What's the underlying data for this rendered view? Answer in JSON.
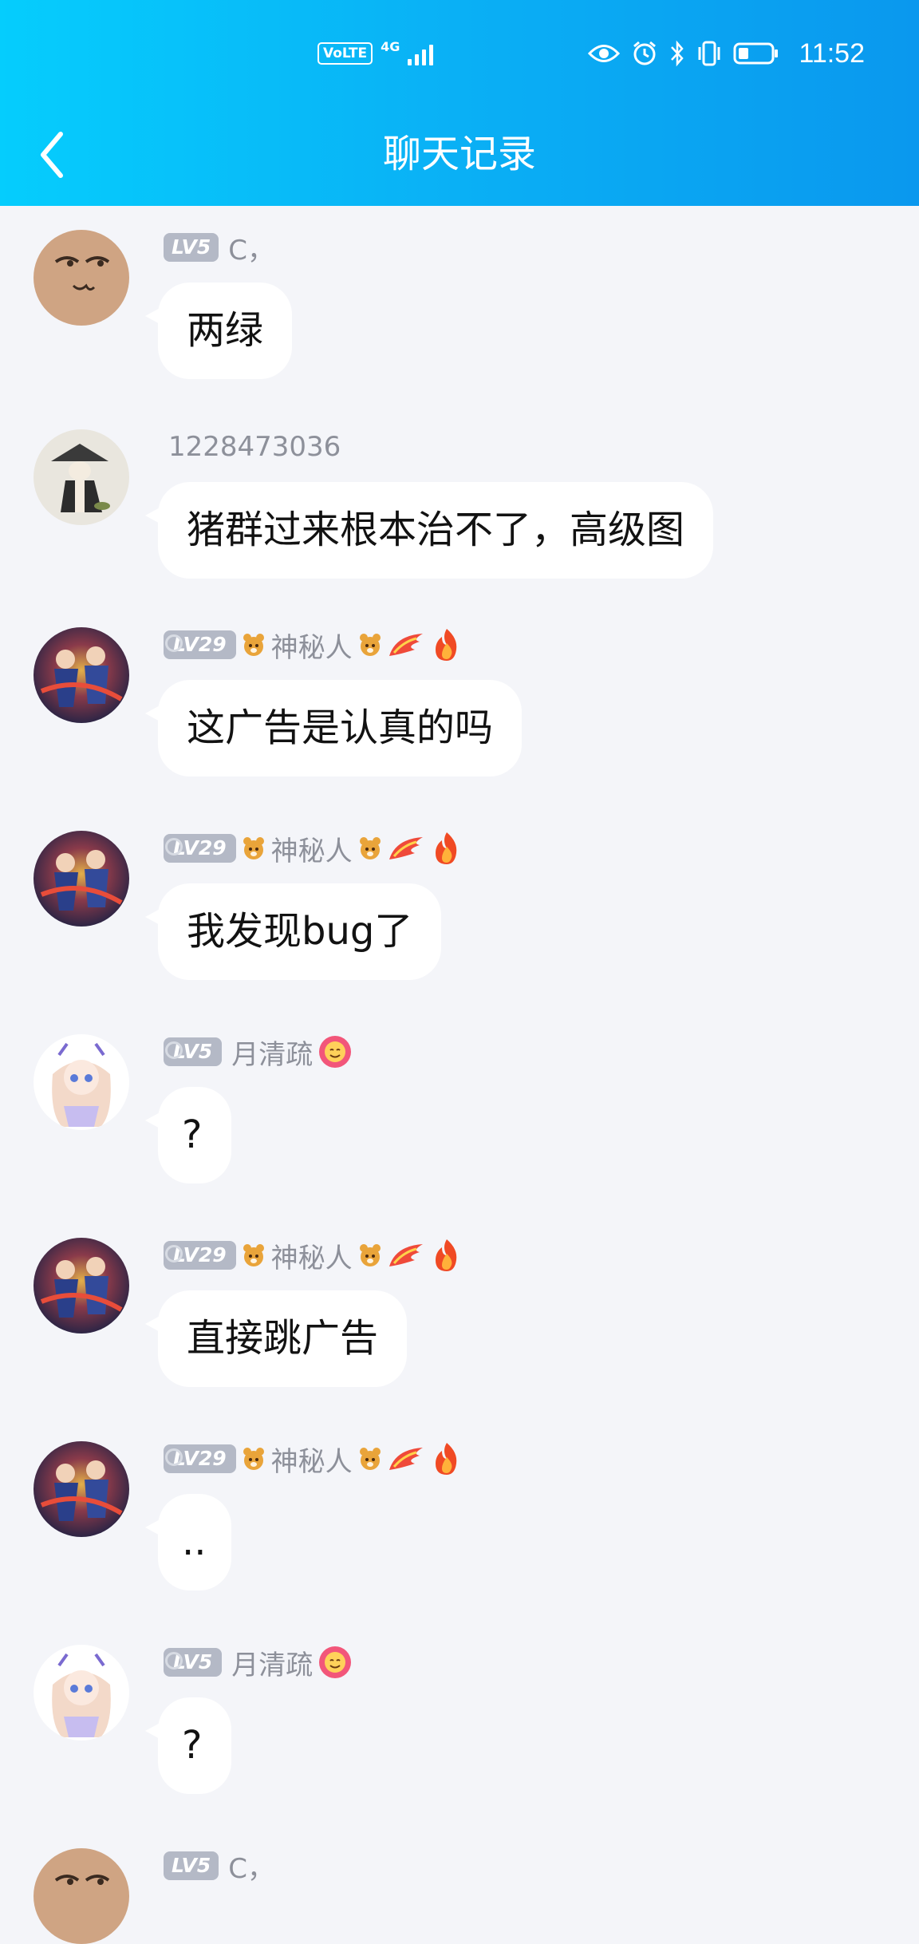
{
  "status_bar": {
    "volte": "VoLTE",
    "network": "4G",
    "time": "11:52"
  },
  "header": {
    "title": "聊天记录"
  },
  "messages": [
    {
      "level": "LV5",
      "name": "C，",
      "text": "两绿",
      "avatar": "face-avatar"
    },
    {
      "level": "",
      "name": "1228473036",
      "text": "猪群过来根本治不了，高级图",
      "avatar": "hermit-avatar"
    },
    {
      "level": "LV29",
      "name": "神秘人",
      "text": "这广告是认真的吗",
      "avatar": "game-avatar"
    },
    {
      "level": "LV29",
      "name": "神秘人",
      "text": "我发现bug了",
      "avatar": "game-avatar"
    },
    {
      "level": "LV5",
      "name": "月清疏",
      "text": "?",
      "avatar": "anime-avatar"
    },
    {
      "level": "LV29",
      "name": "神秘人",
      "text": "直接跳广告",
      "avatar": "game-avatar"
    },
    {
      "level": "LV29",
      "name": "神秘人",
      "text": "..",
      "avatar": "game-avatar"
    },
    {
      "level": "LV5",
      "name": "月清疏",
      "text": "?",
      "avatar": "anime-avatar"
    },
    {
      "level": "LV5",
      "name": "C，",
      "text": "",
      "avatar": "face-avatar"
    }
  ]
}
